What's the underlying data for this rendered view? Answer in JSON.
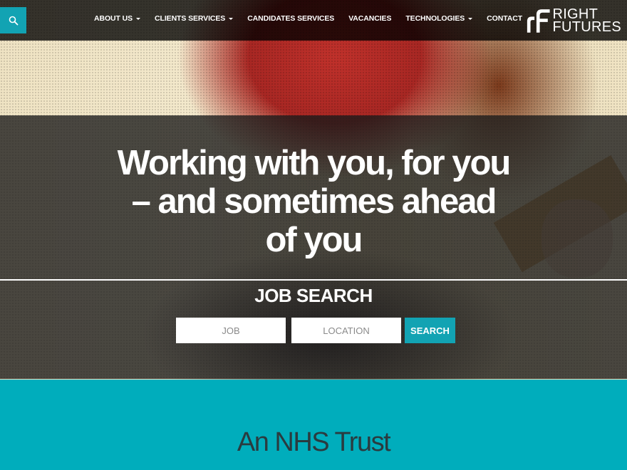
{
  "nav": {
    "items": [
      {
        "label": "ABOUT US",
        "dropdown": true
      },
      {
        "label": "CLIENTS SERVICES",
        "dropdown": true
      },
      {
        "label": "CANDIDATES SERVICES",
        "dropdown": false
      },
      {
        "label": "VACANCIES",
        "dropdown": false
      },
      {
        "label": "TECHNOLOGIES",
        "dropdown": true
      },
      {
        "label": "CONTACT",
        "dropdown": false
      }
    ],
    "search_icon": "search-icon"
  },
  "logo": {
    "line1": "RIGHT",
    "line2": "FUTURES"
  },
  "hero": {
    "headline": "Working with you, for you – and sometimes ahead of you"
  },
  "job_search": {
    "title": "JOB SEARCH",
    "job_placeholder": "JOB",
    "location_placeholder": "LOCATION",
    "submit_label": "SEARCH"
  },
  "section": {
    "title": "An NHS Trust"
  },
  "colors": {
    "accent": "#12a3b3",
    "section_bg": "#00adbc"
  }
}
